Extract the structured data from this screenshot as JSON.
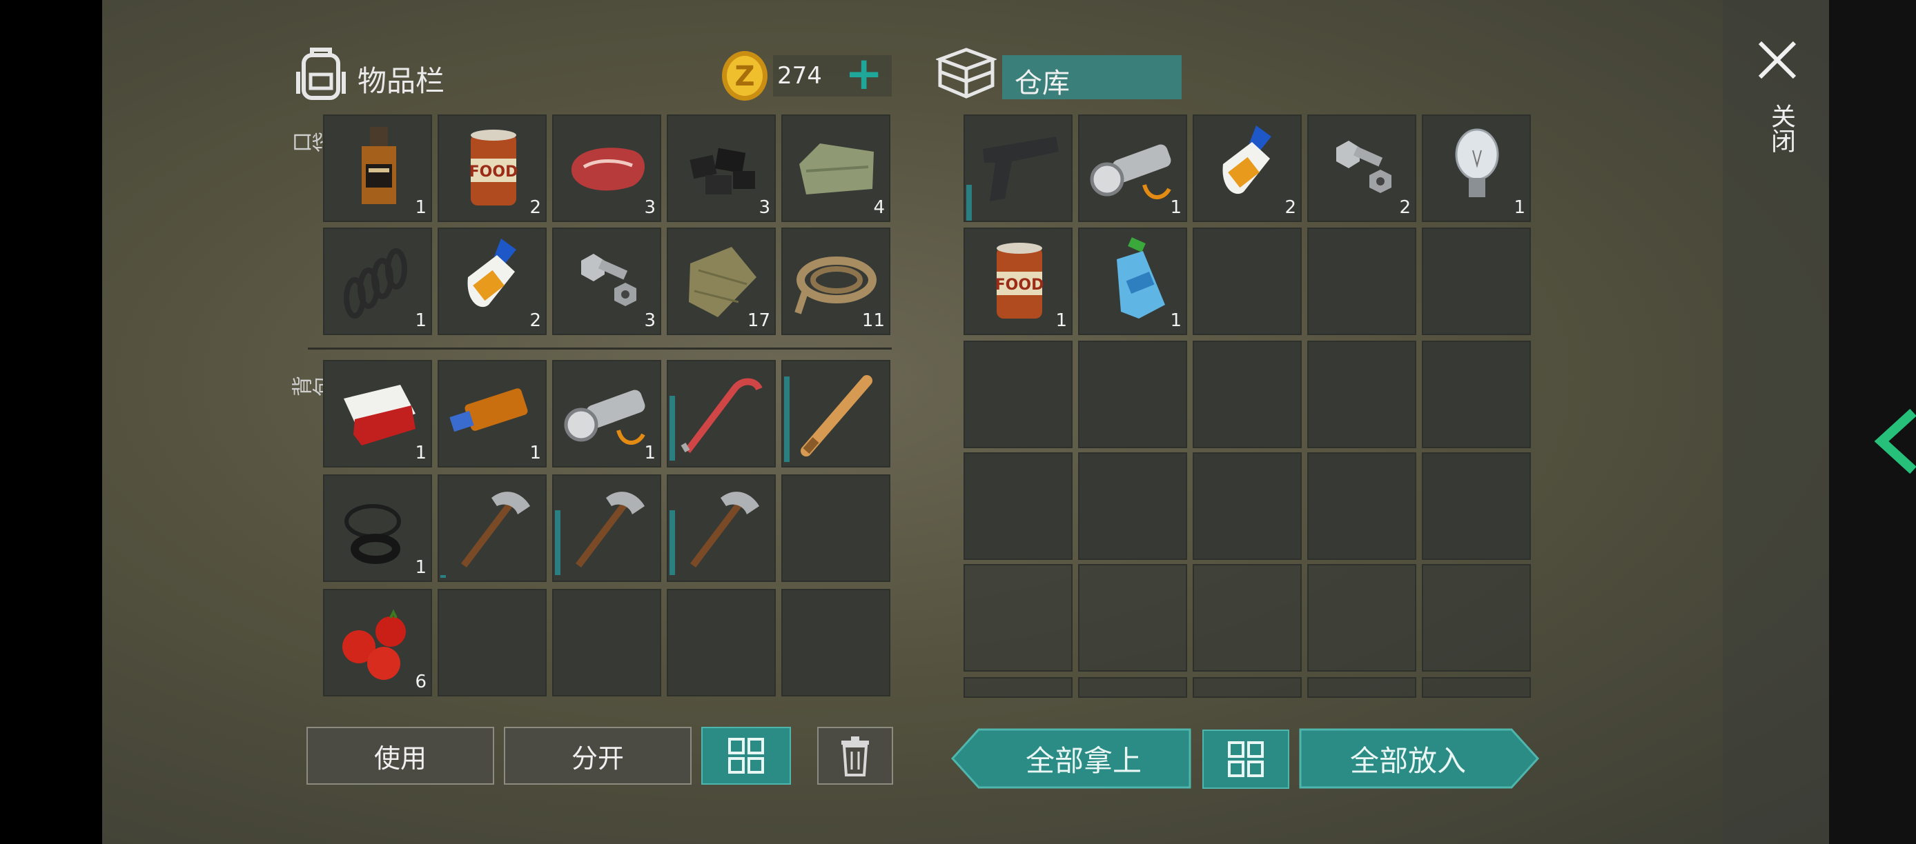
{
  "inventory": {
    "title": "物品栏",
    "coins": "274",
    "pocket_label": "口袋",
    "backpack_label": "背包",
    "pocket_items": [
      {
        "name": "whiskey-bottle-icon",
        "count": "1"
      },
      {
        "name": "canned-food-icon",
        "count": "2"
      },
      {
        "name": "raw-meat-icon",
        "count": "3"
      },
      {
        "name": "coal-icon",
        "count": "3"
      },
      {
        "name": "cloth-icon",
        "count": "4"
      },
      {
        "name": "spring-icon",
        "count": "1"
      },
      {
        "name": "glue-icon",
        "count": "2"
      },
      {
        "name": "bolt-nut-icon",
        "count": "3"
      },
      {
        "name": "burlap-icon",
        "count": "17"
      },
      {
        "name": "rope-icon",
        "count": "11"
      }
    ],
    "backpack_items": [
      {
        "name": "cigarette-pack-icon",
        "count": "1"
      },
      {
        "name": "usb-drive-icon",
        "count": "1"
      },
      {
        "name": "flashlight-icon",
        "count": "1"
      },
      {
        "name": "crowbar-icon",
        "count": ""
      },
      {
        "name": "baseball-bat-icon",
        "count": ""
      },
      {
        "name": "rubber-rings-icon",
        "count": "1"
      },
      {
        "name": "pickaxe-icon",
        "count": ""
      },
      {
        "name": "pickaxe-icon",
        "count": ""
      },
      {
        "name": "pickaxe-icon",
        "count": ""
      },
      {
        "name": "",
        "count": ""
      },
      {
        "name": "tomatoes-icon",
        "count": "6"
      },
      {
        "name": "",
        "count": ""
      },
      {
        "name": "",
        "count": ""
      },
      {
        "name": "",
        "count": ""
      },
      {
        "name": "",
        "count": ""
      }
    ],
    "buttons": {
      "use": "使用",
      "split": "分开"
    }
  },
  "warehouse": {
    "title": "仓库",
    "items": [
      {
        "name": "pistol-icon",
        "count": ""
      },
      {
        "name": "flashlight-icon",
        "count": "1"
      },
      {
        "name": "glue-icon",
        "count": "2"
      },
      {
        "name": "bolt-nut-icon",
        "count": "2"
      },
      {
        "name": "light-bulb-icon",
        "count": "1"
      },
      {
        "name": "canned-food-icon",
        "count": "1"
      },
      {
        "name": "water-bottle-icon",
        "count": "1"
      }
    ],
    "buttons": {
      "take_all": "全部拿上",
      "put_all": "全部放入"
    }
  },
  "close": {
    "label": "关闭"
  },
  "colors": {
    "accent": "#2a8c85",
    "coin": "#e8b321"
  }
}
